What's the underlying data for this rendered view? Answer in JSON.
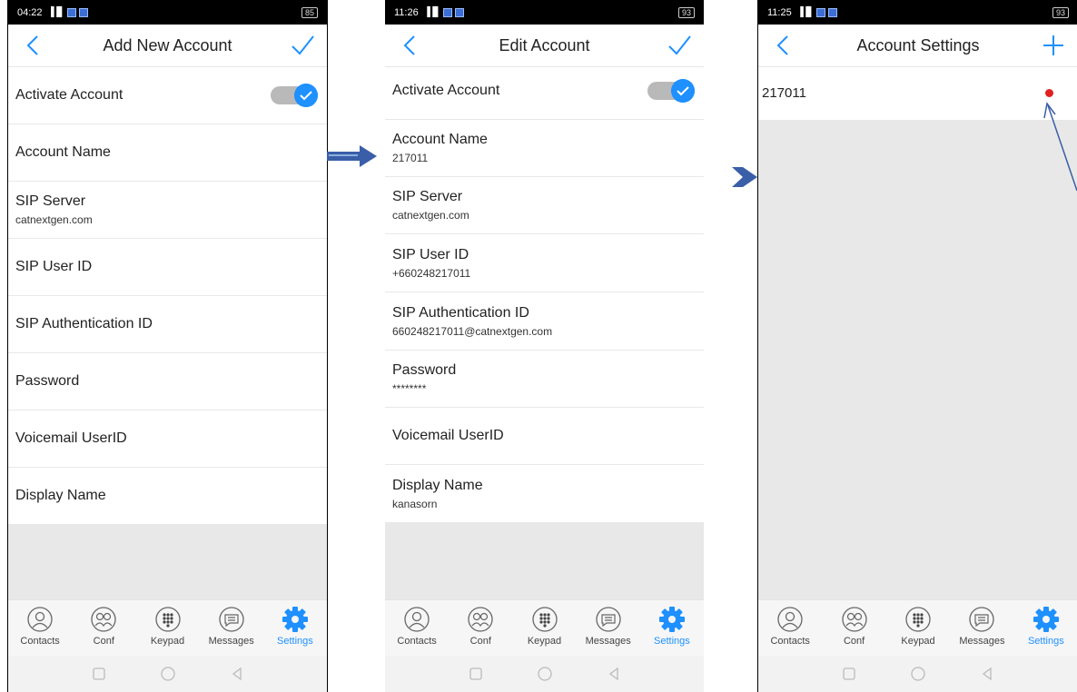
{
  "colors": {
    "accent": "#1e90ff",
    "red_dot": "#e02020",
    "flow_arrow": "#3a5ea8"
  },
  "screens": [
    {
      "status": {
        "time": "04:22",
        "signal": "▐▐▌",
        "battery": "85"
      },
      "header": {
        "title": "Add New Account",
        "back_icon": "chevron-left-icon",
        "action_icon": "check-icon"
      },
      "activate": {
        "label": "Activate Account",
        "enabled": true
      },
      "fields": [
        {
          "label": "Account Name",
          "value": ""
        },
        {
          "label": "SIP Server",
          "value": "catnextgen.com"
        },
        {
          "label": "SIP User ID",
          "value": ""
        },
        {
          "label": "SIP Authentication ID",
          "value": ""
        },
        {
          "label": "Password",
          "value": ""
        },
        {
          "label": "Voicemail UserID",
          "value": ""
        },
        {
          "label": "Display Name",
          "value": ""
        }
      ]
    },
    {
      "status": {
        "time": "11:26",
        "signal": "▐▐▌",
        "battery": "93"
      },
      "header": {
        "title": "Edit Account",
        "back_icon": "chevron-left-icon",
        "action_icon": "check-icon"
      },
      "activate": {
        "label": "Activate Account",
        "enabled": true
      },
      "fields": [
        {
          "label": "Account Name",
          "value": "217011"
        },
        {
          "label": "SIP Server",
          "value": "catnextgen.com"
        },
        {
          "label": "SIP User ID",
          "value": "+660248217011"
        },
        {
          "label": "SIP Authentication ID",
          "value": "660248217011@catnextgen.com"
        },
        {
          "label": "Password",
          "value": "********"
        },
        {
          "label": "Voicemail UserID",
          "value": ""
        },
        {
          "label": "Display Name",
          "value": "kanasorn"
        }
      ]
    },
    {
      "status": {
        "time": "11:25",
        "signal": "▐▐▌",
        "battery": "93"
      },
      "header": {
        "title": "Account Settings",
        "back_icon": "chevron-left-icon",
        "action_icon": "plus-icon"
      },
      "accounts": [
        {
          "name": "217011",
          "status_color": "#e02020"
        }
      ]
    }
  ],
  "tabs": [
    {
      "label": "Contacts",
      "icon": "contacts-icon"
    },
    {
      "label": "Conf",
      "icon": "conference-icon"
    },
    {
      "label": "Keypad",
      "icon": "keypad-icon"
    },
    {
      "label": "Messages",
      "icon": "messages-icon"
    },
    {
      "label": "Settings",
      "icon": "gear-icon",
      "active": true
    }
  ]
}
